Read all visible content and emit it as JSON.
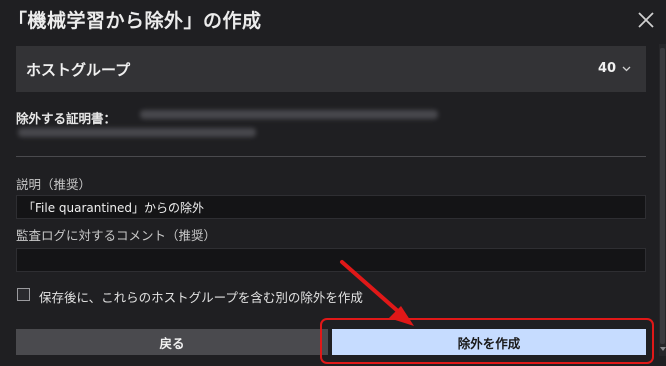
{
  "dialog": {
    "title": "「機械学習から除外」の作成",
    "close_icon": "close-icon"
  },
  "host_group": {
    "label": "ホストグループ",
    "count": "40",
    "chevron_icon": "chevron-down-icon"
  },
  "certificate": {
    "label": "除外する証明書："
  },
  "description": {
    "label": "説明（推奨）",
    "value": "「File quarantined」からの除外"
  },
  "audit_comment": {
    "label": "監査ログに対するコメント（推奨）",
    "value": ""
  },
  "checkbox": {
    "label": "保存後に、これらのホストグループを含む別の除外を作成",
    "checked": false
  },
  "buttons": {
    "back": "戻る",
    "create": "除外を作成"
  },
  "annotation": {
    "color": "#e01818"
  }
}
